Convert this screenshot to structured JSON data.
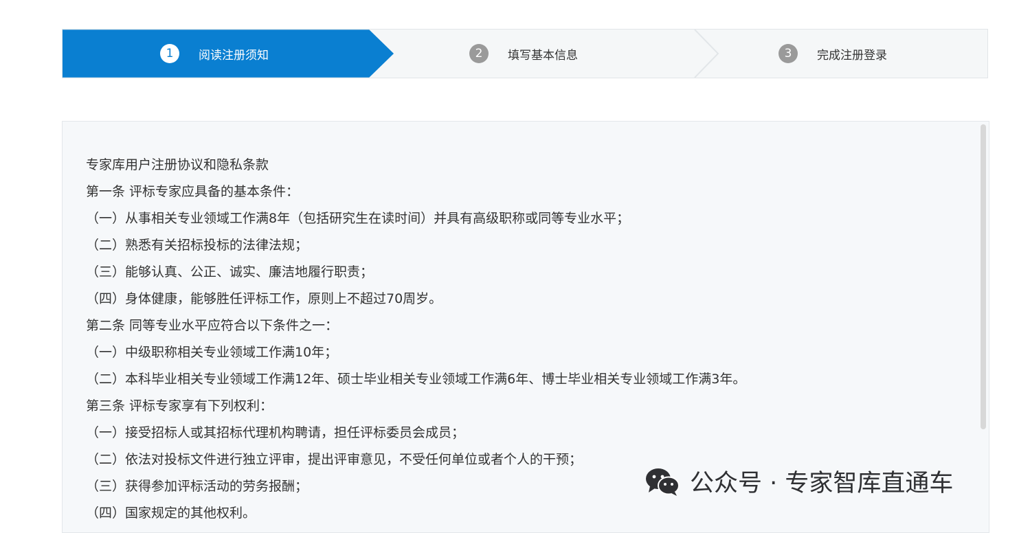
{
  "stepper": {
    "steps": [
      {
        "number": "1",
        "label": "阅读注册须知",
        "state": "active"
      },
      {
        "number": "2",
        "label": "填写基本信息",
        "state": "inactive"
      },
      {
        "number": "3",
        "label": "完成注册登录",
        "state": "inactive"
      }
    ],
    "active_color": "#0a7fd1"
  },
  "agreement": {
    "lines": [
      "专家库用户注册协议和隐私条款",
      "第一条 评标专家应具备的基本条件：",
      "（一）从事相关专业领域工作满8年（包括研究生在读时间）并具有高级职称或同等专业水平；",
      "（二）熟悉有关招标投标的法律法规；",
      "（三）能够认真、公正、诚实、廉洁地履行职责；",
      "（四）身体健康，能够胜任评标工作，原则上不超过70周岁。",
      "第二条 同等专业水平应符合以下条件之一：",
      "（一）中级职称相关专业领域工作满10年；",
      "（二）本科毕业相关专业领域工作满12年、硕士毕业相关专业领域工作满6年、博士毕业相关专业领域工作满3年。",
      "第三条 评标专家享有下列权利：",
      "（一）接受招标人或其招标代理机构聘请，担任评标委员会成员；",
      "（二）依法对投标文件进行独立评审，提出评审意见，不受任何单位或者个人的干预；",
      "（三）获得参加评标活动的劳务报酬；",
      "（四）国家规定的其他权利。"
    ]
  },
  "watermark": {
    "icon": "wechat-icon",
    "text": "公众号 · 专家智库直通车"
  }
}
